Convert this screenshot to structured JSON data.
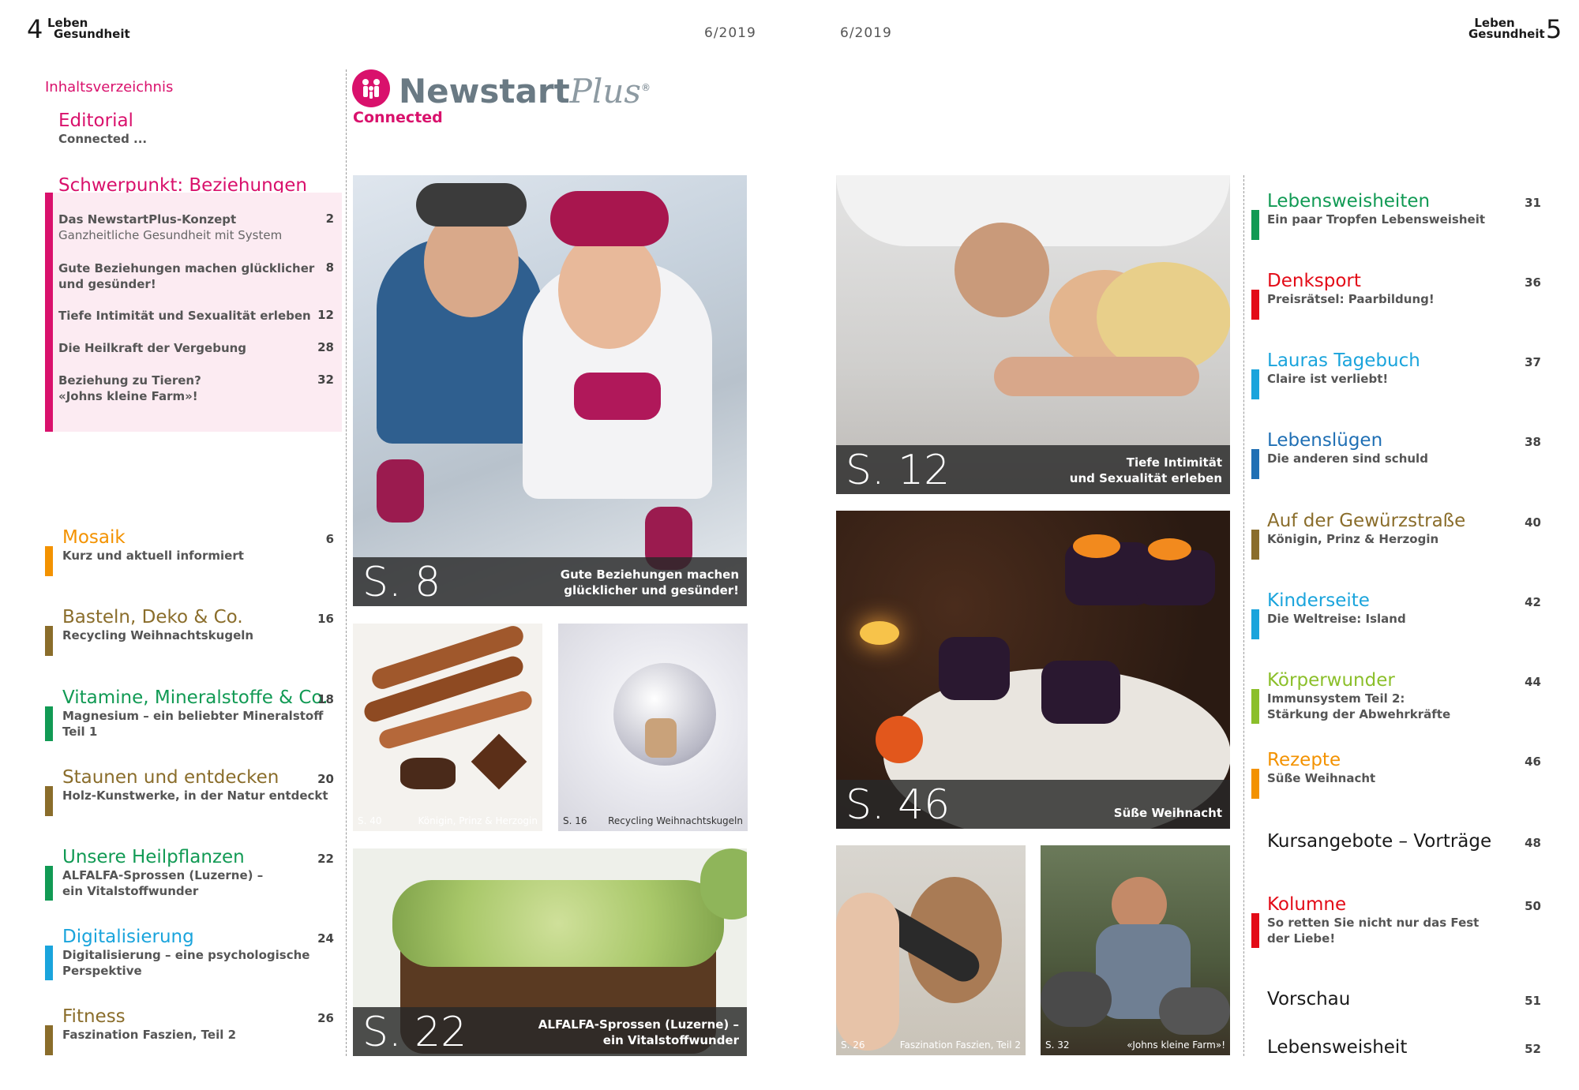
{
  "header": {
    "left_page_number": "4",
    "right_page_number": "5",
    "logo_line1": "Leben",
    "logo_line2": "Gesundheit",
    "issue_left": "6/2019",
    "issue_right": "6/2019"
  },
  "brand": {
    "name_main": "Newstart",
    "name_plus": "Plus",
    "registered": "®",
    "tagline": "Connected"
  },
  "colors": {
    "pink": "#d9116c",
    "orange": "#f39200",
    "olive": "#8a6d2b",
    "green": "#119a54",
    "cyan": "#1aa4dc",
    "red": "#e30b17",
    "blue": "#1f6fb4",
    "lime": "#8bbf2a"
  },
  "toc": {
    "heading": "Inhaltsverzeichnis",
    "editorial": {
      "title": "Editorial",
      "subtitle": "Connected ..."
    },
    "focus": {
      "title": "Schwerpunkt: Beziehungen",
      "items": [
        {
          "title": "Das NewstartPlus-Konzept",
          "subtitle": "Ganzheitliche Gesundheit mit System",
          "page": "2"
        },
        {
          "title": "Gute Beziehungen machen glücklicher",
          "title2": "und gesünder!",
          "page": "8"
        },
        {
          "title": "Tiefe Intimität und Sexualität erleben",
          "page": "12"
        },
        {
          "title": "Die Heilkraft der Vergebung",
          "page": "28"
        },
        {
          "title": "Beziehung zu Tieren?",
          "title2": "«Johns kleine Farm»!",
          "page": "32"
        }
      ]
    },
    "left_sections": [
      {
        "title": "Mosaik",
        "sub1": "Kurz und aktuell informiert",
        "sub2": "",
        "page": "6",
        "color": "orange"
      },
      {
        "title": "Basteln, Deko & Co.",
        "sub1": "Recycling Weihnachtskugeln",
        "sub2": "",
        "page": "16",
        "color": "olive"
      },
      {
        "title": "Vitamine, Mineralstoffe & Co.",
        "sub1": "Magnesium – ein beliebter Mineralstoff",
        "sub2": "Teil 1",
        "page": "18",
        "color": "green"
      },
      {
        "title": "Staunen und entdecken",
        "sub1": "Holz-Kunstwerke, in der Natur entdeckt",
        "sub2": "",
        "page": "20",
        "color": "olive"
      },
      {
        "title": "Unsere Heilpflanzen",
        "sub1": "ALFALFA-Sprossen (Luzerne) –",
        "sub2": "ein Vitalstoffwunder",
        "page": "22",
        "color": "green"
      },
      {
        "title": "Digitalisierung",
        "sub1": "Digitalisierung – eine psychologische",
        "sub2": "Perspektive",
        "page": "24",
        "color": "cyan"
      },
      {
        "title": "Fitness",
        "sub1": "Faszination Faszien, Teil 2",
        "sub2": "",
        "page": "26",
        "color": "olive"
      }
    ],
    "right_sections": [
      {
        "title": "Lebensweisheiten",
        "sub1": "Ein paar Tropfen Lebensweisheit",
        "sub2": "",
        "page": "31",
        "color": "green"
      },
      {
        "title": "Denksport",
        "sub1": "Preisrätsel: Paarbildung!",
        "sub2": "",
        "page": "36",
        "color": "red"
      },
      {
        "title": "Lauras Tagebuch",
        "sub1": "Claire ist verliebt!",
        "sub2": "",
        "page": "37",
        "color": "cyan"
      },
      {
        "title": "Lebenslügen",
        "sub1": "Die anderen sind schuld",
        "sub2": "",
        "page": "38",
        "color": "blue"
      },
      {
        "title": "Auf der Gewürzstraße",
        "sub1": "Königin, Prinz & Herzogin",
        "sub2": "",
        "page": "40",
        "color": "olive"
      },
      {
        "title": "Kinderseite",
        "sub1": "Die Weltreise: Island",
        "sub2": "",
        "page": "42",
        "color": "cyan"
      },
      {
        "title": "Körperwunder",
        "sub1": "Immunsystem Teil 2:",
        "sub2": "Stärkung der Abwehrkräfte",
        "page": "44",
        "color": "lime"
      },
      {
        "title": "Rezepte",
        "sub1": "Süße Weihnacht",
        "sub2": "",
        "page": "46",
        "color": "orange"
      },
      {
        "title": "Kursangebote – Vorträge",
        "sub1": "",
        "sub2": "",
        "page": "48",
        "color": ""
      },
      {
        "title": "Kolumne",
        "sub1": "So retten Sie nicht nur das Fest",
        "sub2": "der Liebe!",
        "page": "50",
        "color": "red"
      },
      {
        "title": "Vorschau",
        "sub1": "",
        "sub2": "",
        "page": "51",
        "color": ""
      },
      {
        "title": "Lebensweisheit",
        "sub1": "",
        "sub2": "",
        "page": "52",
        "color": ""
      }
    ]
  },
  "photos": {
    "p8": {
      "big": "S. 8",
      "line1": "Gute Beziehungen machen",
      "line2": "glücklicher und gesünder!"
    },
    "p40": {
      "pg": "S. 40",
      "text": "Königin, Prinz & Herzogin"
    },
    "p16": {
      "pg": "S. 16",
      "text": "Recycling Weihnachtskugeln"
    },
    "p22": {
      "big": "S. 22",
      "line1": "ALFALFA-Sprossen (Luzerne) –",
      "line2": "ein Vitalstoffwunder"
    },
    "p12": {
      "big": "S. 12",
      "line1": "Tiefe Intimität",
      "line2": "und Sexualität erleben"
    },
    "p46": {
      "big": "S. 46",
      "line1": "Süße Weihnacht",
      "line2": ""
    },
    "p26": {
      "pg": "S. 26",
      "text": "Faszination Faszien, Teil 2"
    },
    "p32": {
      "pg": "S. 32",
      "text": "«Johns kleine Farm»!"
    }
  }
}
